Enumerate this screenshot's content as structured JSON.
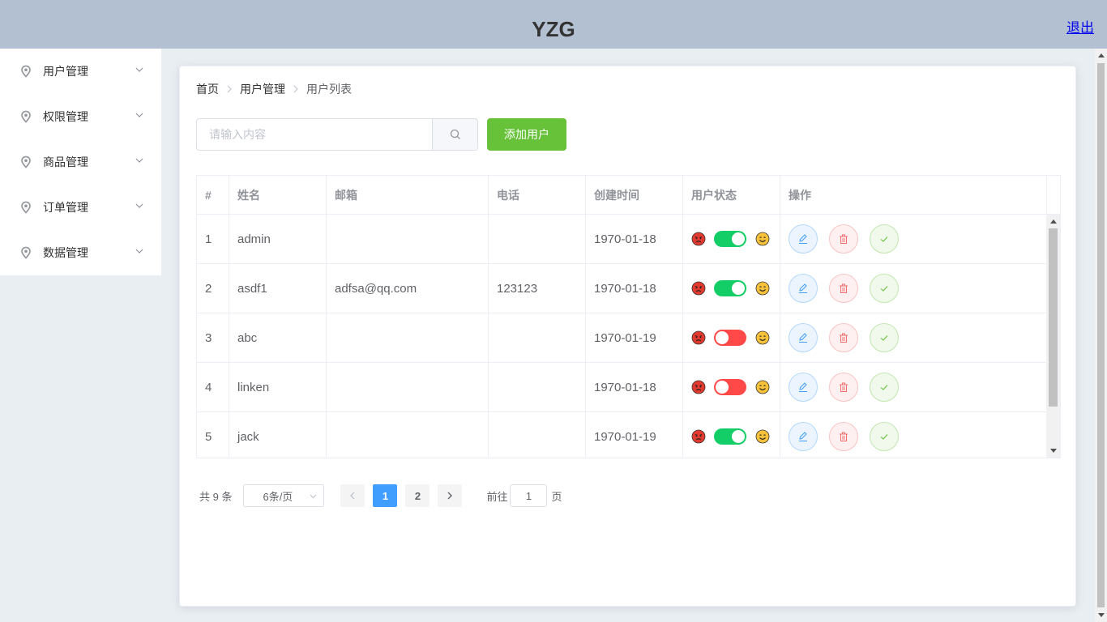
{
  "header": {
    "title": "YZG",
    "logout_label": "退出"
  },
  "sidebar": {
    "items": [
      {
        "label": "用户管理",
        "icon": "location-pin-icon"
      },
      {
        "label": "权限管理",
        "icon": "location-pin-icon"
      },
      {
        "label": "商品管理",
        "icon": "location-pin-icon"
      },
      {
        "label": "订单管理",
        "icon": "location-pin-icon"
      },
      {
        "label": "数据管理",
        "icon": "location-pin-icon"
      }
    ]
  },
  "breadcrumb": [
    "首页",
    "用户管理",
    "用户列表"
  ],
  "search": {
    "placeholder": "请输入内容",
    "value": ""
  },
  "toolbar": {
    "add_label": "添加用户"
  },
  "table": {
    "columns": [
      "#",
      "姓名",
      "邮箱",
      "电话",
      "创建时间",
      "用户状态",
      "操作"
    ],
    "rows": [
      {
        "index": "1",
        "name": "admin",
        "email": "",
        "phone": "",
        "created": "1970-01-18",
        "enabled": true
      },
      {
        "index": "2",
        "name": "asdf1",
        "email": "adfsa@qq.com",
        "phone": "123123",
        "created": "1970-01-18",
        "enabled": true
      },
      {
        "index": "3",
        "name": "abc",
        "email": "",
        "phone": "",
        "created": "1970-01-19",
        "enabled": false
      },
      {
        "index": "4",
        "name": "linken",
        "email": "",
        "phone": "",
        "created": "1970-01-18",
        "enabled": false
      },
      {
        "index": "5",
        "name": "jack",
        "email": "",
        "phone": "",
        "created": "1970-01-19",
        "enabled": true
      }
    ]
  },
  "pagination": {
    "total_text": "共 9 条",
    "page_size": "6条/页",
    "pages": [
      "1",
      "2"
    ],
    "current_page": "1",
    "goto_prefix": "前往",
    "goto_value": "1",
    "goto_suffix": "页"
  },
  "colors": {
    "header_bg": "#b3c0d1",
    "primary": "#409eff",
    "success": "#67c23a",
    "switch_on": "#13ce66",
    "switch_off": "#ff4949"
  }
}
